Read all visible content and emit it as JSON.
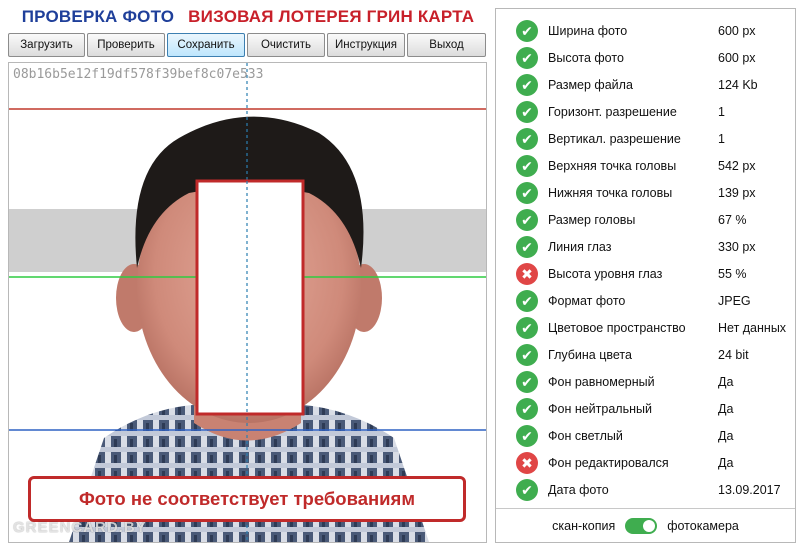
{
  "header": {
    "title_left": "ПРОВЕРКА ФОТО",
    "title_right": "ВИЗОВАЯ ЛОТЕРЕЯ ГРИН КАРТА"
  },
  "toolbar": {
    "buttons": [
      {
        "label": "Загрузить"
      },
      {
        "label": "Проверить"
      },
      {
        "label": "Сохранить"
      },
      {
        "label": "Очистить"
      },
      {
        "label": "Инструкция"
      },
      {
        "label": "Выход"
      }
    ]
  },
  "photo": {
    "hash": "08b16b5e12f19df578f39bef8c07e533",
    "error_message": "Фото не соответствует требованиям",
    "watermark": "GREENCARD.BY",
    "guide_colors": {
      "top": "#c0392b",
      "eyes": "#2ecc40",
      "bottom": "#2f62c4",
      "center": "#2b7fb0",
      "eye_band": "#cfcfcf"
    }
  },
  "checks": [
    {
      "label": "Ширина фото",
      "value": "600 px",
      "status": "ok"
    },
    {
      "label": "Высота фото",
      "value": "600 px",
      "status": "ok"
    },
    {
      "label": "Размер файла",
      "value": "124 Kb",
      "status": "ok"
    },
    {
      "label": "Горизонт. разрешение",
      "value": "1",
      "status": "ok"
    },
    {
      "label": "Вертикал. разрешение",
      "value": "1",
      "status": "ok"
    },
    {
      "label": "Верхняя точка головы",
      "value": "542 px",
      "status": "ok"
    },
    {
      "label": "Нижняя точка головы",
      "value": "139 px",
      "status": "ok"
    },
    {
      "label": "Размер головы",
      "value": "67 %",
      "status": "ok"
    },
    {
      "label": "Линия глаз",
      "value": "330 px",
      "status": "ok"
    },
    {
      "label": "Высота уровня глаз",
      "value": "55 %",
      "status": "fail"
    },
    {
      "label": "Формат фото",
      "value": "JPEG",
      "status": "ok"
    },
    {
      "label": "Цветовое пространство",
      "value": "Нет данных",
      "status": "ok"
    },
    {
      "label": "Глубина цвета",
      "value": "24 bit",
      "status": "ok"
    },
    {
      "label": "Фон равномерный",
      "value": "Да",
      "status": "ok"
    },
    {
      "label": "Фон нейтральный",
      "value": "Да",
      "status": "ok"
    },
    {
      "label": "Фон светлый",
      "value": "Да",
      "status": "ok"
    },
    {
      "label": "Фон редактировался",
      "value": "Да",
      "status": "fail"
    },
    {
      "label": "Дата фото",
      "value": "13.09.2017",
      "status": "ok"
    }
  ],
  "source_toggle": {
    "left_label": "скан-копия",
    "right_label": "фотокамера",
    "selected": "фотокамера"
  },
  "icons": {
    "ok": "check-circle-icon",
    "fail": "cross-circle-icon"
  },
  "colors": {
    "ok": "#3fad4f",
    "fail": "#e04646",
    "title_left": "#1f3f9a",
    "title_right": "#c8202a"
  }
}
